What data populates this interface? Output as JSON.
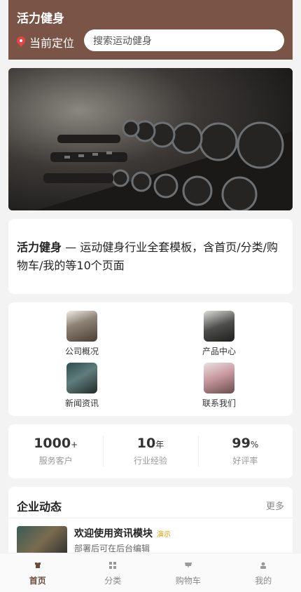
{
  "header": {
    "title": "活力健身",
    "location_label": "当前定位",
    "search_placeholder": "搜索运动健身"
  },
  "intro": {
    "brand": "活力健身",
    "text": " — 运动健身行业全套模板，含首页/分类/购物车/我的等10个页面"
  },
  "nav": [
    {
      "label": "公司概况",
      "icon": "company-photo"
    },
    {
      "label": "产品中心",
      "icon": "product-photo"
    },
    {
      "label": "新闻资讯",
      "icon": "news-photo"
    },
    {
      "label": "联系我们",
      "icon": "contact-photo"
    }
  ],
  "stats": [
    {
      "num": "1000",
      "unit": "+",
      "label": "服务客户"
    },
    {
      "num": "10",
      "unit": "年",
      "label": "行业经验"
    },
    {
      "num": "99",
      "unit": "%",
      "label": "好评率"
    }
  ],
  "news": {
    "title": "企业动态",
    "more": "更多",
    "item": {
      "headline": "欢迎使用资讯模块",
      "badge": "演示",
      "subtitle": "部署后可在后台编辑"
    }
  },
  "tabs": [
    {
      "label": "首页",
      "icon": "shirt-icon",
      "active": true
    },
    {
      "label": "分类",
      "icon": "grid-icon",
      "active": false
    },
    {
      "label": "购物车",
      "icon": "cart-icon",
      "active": false
    },
    {
      "label": "我的",
      "icon": "user-icon",
      "active": false
    }
  ],
  "colors": {
    "brand": "#7a5547",
    "active_tab": "#6e4a3c",
    "badge": "#d9a200"
  }
}
